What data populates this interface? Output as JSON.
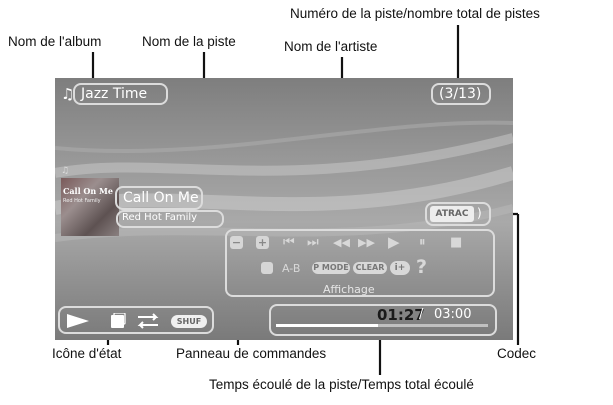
{
  "callouts": {
    "track_number": "Numéro de la piste/nombre total de pistes",
    "album_name": "Nom de l'album",
    "track_name": "Nom de la piste",
    "artist_name": "Nom de l'artiste",
    "status_icon": "Icône d'état",
    "control_panel": "Panneau de commandes",
    "codec": "Codec",
    "elapsed_total": "Temps écoulé de la piste/Temps total écoulé"
  },
  "player": {
    "album": "Jazz Time",
    "track_counter": "(3/13)",
    "track_title": "Call On Me",
    "artist": "Red Hot Family",
    "codec": "ATRAC",
    "album_art_title": "Call On Me",
    "album_art_subtitle": "Red Hot Family",
    "elapsed_time": "01:27",
    "time_separator": " / ",
    "total_time": "03:00",
    "progress_fraction": 0.48,
    "shuffle_label": "SHUF",
    "controls": {
      "minus": "−",
      "plus": "+",
      "prev_track": "⏮",
      "next_track": "⏭",
      "rewind": "◀◀",
      "fast_forward": "▶▶",
      "play": "▶",
      "pause": "⏸",
      "stop": "■",
      "ab_repeat": "A-B",
      "pmode": "P MODE",
      "clear": "CLEAR",
      "info": "i+",
      "help": "?",
      "display": "Affichage"
    }
  },
  "icons": {
    "music_note": "♫",
    "status_play": "play-icon",
    "status_repeat": "repeat-icon",
    "status_square": "square-icon"
  },
  "colors": {
    "overlay_text": "#ffffff",
    "box_border": "#dcdcdc",
    "screen_bg": "#969696"
  }
}
